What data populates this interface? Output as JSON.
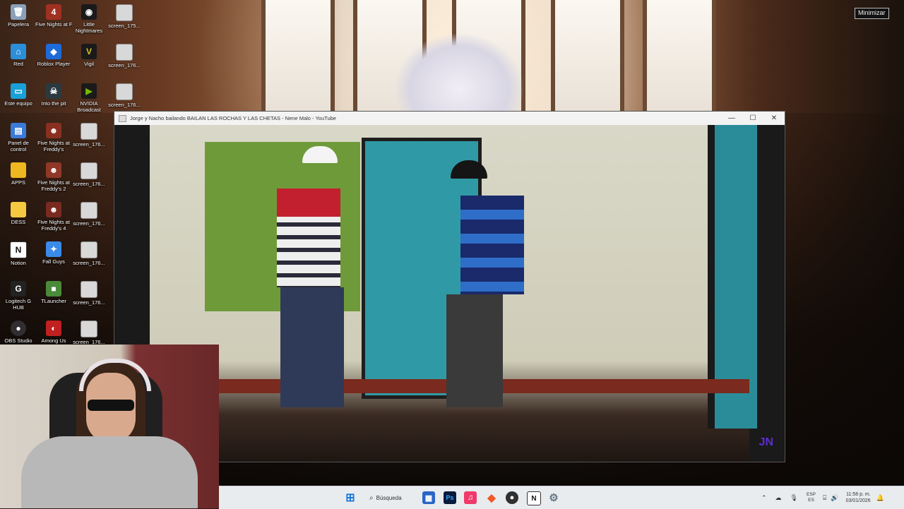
{
  "desktop": {
    "overlay_text": "",
    "minimize_label": "Minimizar",
    "icons": [
      {
        "label": "Papelera",
        "icon": "recycle-bin-icon",
        "color": "#8aa0b8"
      },
      {
        "label": "Red",
        "icon": "network-icon",
        "color": "#2a8fd8"
      },
      {
        "label": "Este equipo",
        "icon": "computer-icon",
        "color": "#1aa0d8"
      },
      {
        "label": "Panel de control",
        "icon": "control-panel-icon",
        "color": "#3a7ad8"
      },
      {
        "label": "APPS",
        "icon": "folder-icon",
        "color": "#f0b820"
      },
      {
        "label": "DESS",
        "icon": "folder-icon",
        "color": "#f5c842"
      },
      {
        "label": "Notion",
        "icon": "notion-icon",
        "color": "#ffffff"
      },
      {
        "label": "Logitech G HUB",
        "icon": "logitech-icon",
        "color": "#222222"
      },
      {
        "label": "OBS Studio",
        "icon": "obs-icon",
        "color": "#302e31"
      },
      {
        "label": "Five Nights at Freddy's 2",
        "icon": "game-icon",
        "color": "#a03020"
      },
      {
        "label": "Roblox Player",
        "icon": "roblox-icon",
        "color": "#1e6ad8"
      },
      {
        "label": "Into the pit",
        "icon": "game-icon",
        "color": "#2a3a40"
      },
      {
        "label": "Five Nights at Freddy's",
        "icon": "game-icon",
        "color": "#8a3020"
      },
      {
        "label": "Five Nights at Freddy's 2",
        "icon": "game-icon",
        "color": "#903828"
      },
      {
        "label": "Five Nights at Freddy's 4",
        "icon": "game-icon",
        "color": "#7a2a20"
      },
      {
        "label": "Fall Guys",
        "icon": "fall-guys-icon",
        "color": "#3a8ae8"
      },
      {
        "label": "TLauncher",
        "icon": "minecraft-icon",
        "color": "#4a8a3a"
      },
      {
        "label": "Among Us",
        "icon": "among-us-icon",
        "color": "#c02020"
      },
      {
        "label": "Little Nightmares",
        "icon": "eye-icon",
        "color": "#1a1a1a"
      },
      {
        "label": "Vigil",
        "icon": "vigil-icon",
        "color": "#d8c020"
      },
      {
        "label": "NVIDIA Broadcast",
        "icon": "nvidia-icon",
        "color": "#1a1a1a"
      },
      {
        "label": "screen_176...",
        "icon": "screenshot-icon",
        "color": "#d8d8d8"
      },
      {
        "label": "screen_176...",
        "icon": "screenshot-icon",
        "color": "#d8d8d8"
      },
      {
        "label": "screen_176...",
        "icon": "screenshot-icon",
        "color": "#d8d8d8"
      },
      {
        "label": "screen_176...",
        "icon": "screenshot-icon",
        "color": "#d8d8d8"
      },
      {
        "label": "screen_176...",
        "icon": "screenshot-icon",
        "color": "#d8d8d8"
      },
      {
        "label": "screen_176...",
        "icon": "screenshot-icon",
        "color": "#d8d8d8"
      },
      {
        "label": "screen_175...",
        "icon": "screenshot-icon",
        "color": "#d8d8d8"
      },
      {
        "label": "screen_176...",
        "icon": "screenshot-icon",
        "color": "#d8d8d8"
      },
      {
        "label": "screen_176...",
        "icon": "screenshot-icon",
        "color": "#d8d8d8"
      },
      {
        "label": "screen_176...",
        "icon": "screenshot-icon",
        "color": "#d8d8d8"
      }
    ]
  },
  "window": {
    "title": "Jorge y Nacho bailando BAILAN LAS ROCHAS Y LAS CHETAS - Nene Malo - YouTube",
    "minimize_glyph": "—",
    "maximize_glyph": "☐",
    "close_glyph": "✕",
    "channel_logo": "JN"
  },
  "taskbar": {
    "search_label": "Búsqueda",
    "apps": [
      {
        "icon": "windows-start-icon",
        "color": "#1a78d8",
        "glyph": "⊞"
      },
      {
        "icon": "file-explorer-icon",
        "color": "#2a66c8",
        "glyph": "▦"
      },
      {
        "icon": "photoshop-icon",
        "color": "#0a1a3a",
        "glyph": "Ps"
      },
      {
        "icon": "itunes-icon",
        "color": "#f03a6a",
        "glyph": "♫"
      },
      {
        "icon": "brave-icon",
        "color": "#f05a28",
        "glyph": "◆"
      },
      {
        "icon": "obs-icon",
        "color": "#303030",
        "glyph": "●"
      },
      {
        "icon": "notion-icon",
        "color": "#222222",
        "glyph": "N"
      },
      {
        "icon": "settings-icon",
        "color": "#6a7a8a",
        "glyph": "⚙"
      }
    ],
    "lang_line1": "ESP",
    "lang_line2": "ES",
    "time": "11:58 p. m.",
    "date": "03/01/2026"
  }
}
